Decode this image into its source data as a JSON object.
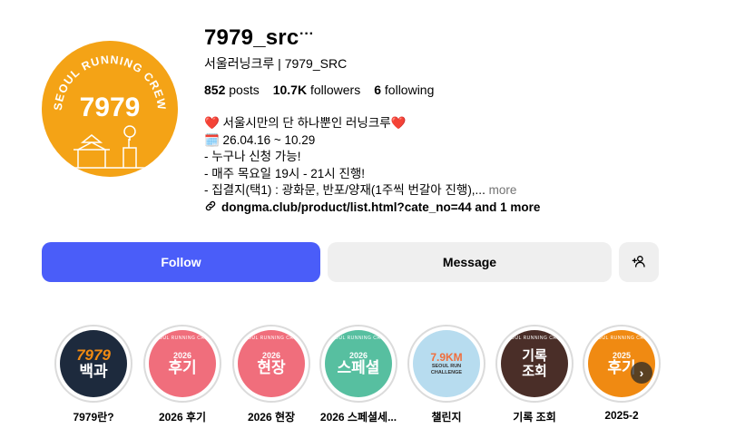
{
  "profile": {
    "avatar": {
      "arc_text": "SEOUL RUNNING CREW",
      "number": "7979",
      "color": "#f4a316"
    },
    "username": "7979_src",
    "more_icon": "more-dots-icon",
    "full_name": "서울러닝크루 | 7979_SRC",
    "stats": {
      "posts_count": "852",
      "posts_label": "posts",
      "followers_count": "10.7K",
      "followers_label": "followers",
      "following_count": "6",
      "following_label": "following"
    },
    "bio": {
      "line1": "❤️ 서울시만의 단 하나뿐인 러닝크루❤️",
      "line2": "🗓️ 26.04.16 ~ 10.29",
      "line3": "- 누구나 신청 가능!",
      "line4": "- 매주 목요일 19시 - 21시 진행!",
      "line5": "- 집결지(택1) : 광화문, 반포/양재(1주씩 번갈아 진행),...",
      "more": "more"
    },
    "link": {
      "icon": "link-icon",
      "text": "dongma.club/product/list.html?cate_no=44 and 1 more"
    }
  },
  "actions": {
    "follow": "Follow",
    "message": "Message",
    "suggest_icon": "add-person-icon",
    "follow_color": "#4a5df9"
  },
  "highlights": [
    {
      "title": "7979란?",
      "cover_text": "7979\n백과",
      "colors": [
        "#1d2a3d",
        "#1d2a3d"
      ]
    },
    {
      "title": "2026 후기",
      "cover_year": "2026",
      "cover_text": "후기",
      "arc": "SEOUL RUNNING CREW",
      "colors": [
        "#f06e7c",
        "#f06e7c"
      ]
    },
    {
      "title": "2026 현장",
      "cover_year": "2026",
      "cover_text": "현장",
      "arc": "SEOUL RUNNING CREW",
      "colors": [
        "#f06e7c",
        "#f06e7c"
      ]
    },
    {
      "title": "2026 스페셜세...",
      "cover_year": "2026",
      "cover_text": "스페셜",
      "arc": "SEOUL RUNNING CREW",
      "colors": [
        "#57bfa0",
        "#57bfa0"
      ]
    },
    {
      "title": "챌린지",
      "cover_text": "7.9KM",
      "cover_sub": "SEOUL RUN CHALLENGE",
      "colors": [
        "#b7dcef",
        "#b7dcef"
      ]
    },
    {
      "title": "기록 조회",
      "cover_text": "기록\n조회",
      "arc": "SEOUL RUNNING CREW",
      "colors": [
        "#4a2e28",
        "#4a2e28"
      ]
    },
    {
      "title": "2025-2",
      "cover_year": "2025",
      "cover_text": "후기",
      "arc": "SEOUL RUNNING CREW",
      "colors": [
        "#f08a12",
        "#f08a12"
      ]
    }
  ],
  "next_icon": "chevron-right-icon"
}
